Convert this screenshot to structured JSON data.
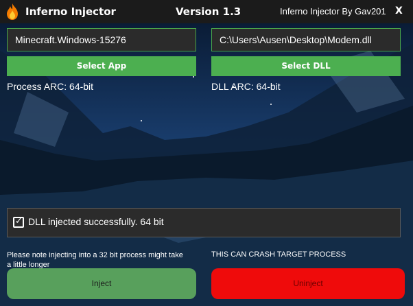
{
  "titlebar": {
    "app_title": "Inferno Injector",
    "version": "Version 1.3",
    "credit": "Inferno Injector By Gav201",
    "close_label": "X",
    "icon": "flame-icon"
  },
  "inputs": {
    "app_value": "Minecraft.Windows-15276",
    "dll_value": "C:\\Users\\Ausen\\Desktop\\Modem.dll"
  },
  "buttons": {
    "select_app": "Select App",
    "select_dll": "Select DLL",
    "inject": "Inject",
    "uninject": "Uninject"
  },
  "info": {
    "process_arc": "Process ARC: 64-bit",
    "dll_arc": "DLL ARC: 64-bit"
  },
  "status": {
    "checked": true,
    "text": "DLL injected successfully. 64 bit"
  },
  "notes": {
    "injection_note": "Please note injecting into a 32 bit process might take a little longer",
    "warning": "THIS CAN CRASH TARGET PROCESS"
  },
  "colors": {
    "accent_green": "#4caf50",
    "inject_green": "#58a05c",
    "uninject_red": "#ef0b0b",
    "panel_dark": "#2b2b2b",
    "titlebar": "#1b1b1b"
  }
}
